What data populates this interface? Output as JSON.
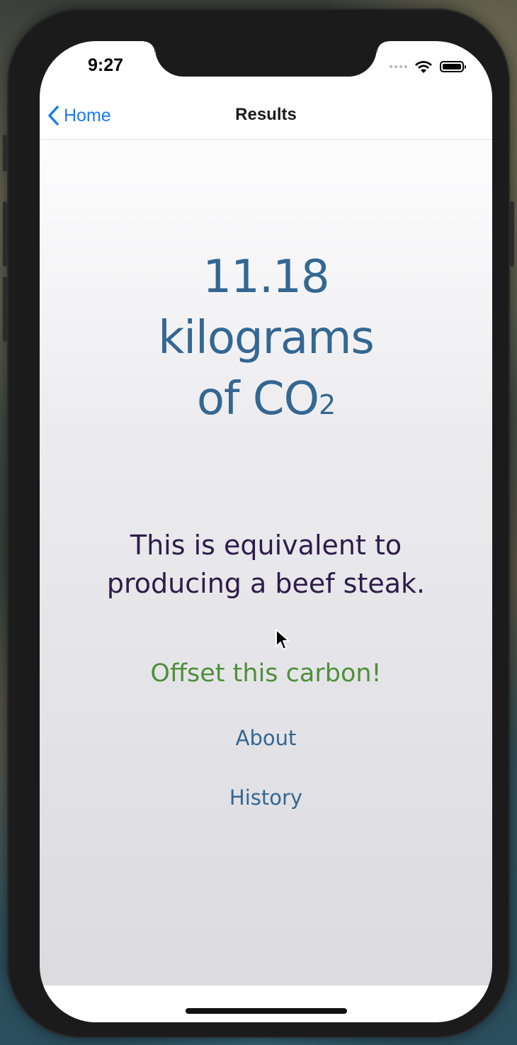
{
  "status_bar": {
    "time": "9:27",
    "icons": [
      "cellular-signal-icon",
      "wifi-icon",
      "battery-icon"
    ]
  },
  "navbar": {
    "back_label": "Home",
    "title": "Results"
  },
  "result": {
    "amount": "11.18",
    "unit": "kilograms",
    "of_prefix": "of CO",
    "subscript": "2"
  },
  "equivalent": {
    "line1": "This is equivalent to",
    "line2": "producing a beef steak."
  },
  "actions": {
    "offset_label": "Offset this carbon!",
    "about_label": "About",
    "history_label": "History"
  },
  "colors": {
    "link_blue": "#1a7cf2",
    "result_blue": "#346792",
    "equivalent_purple": "#2e1c48",
    "offset_green": "#4f8f3a"
  }
}
